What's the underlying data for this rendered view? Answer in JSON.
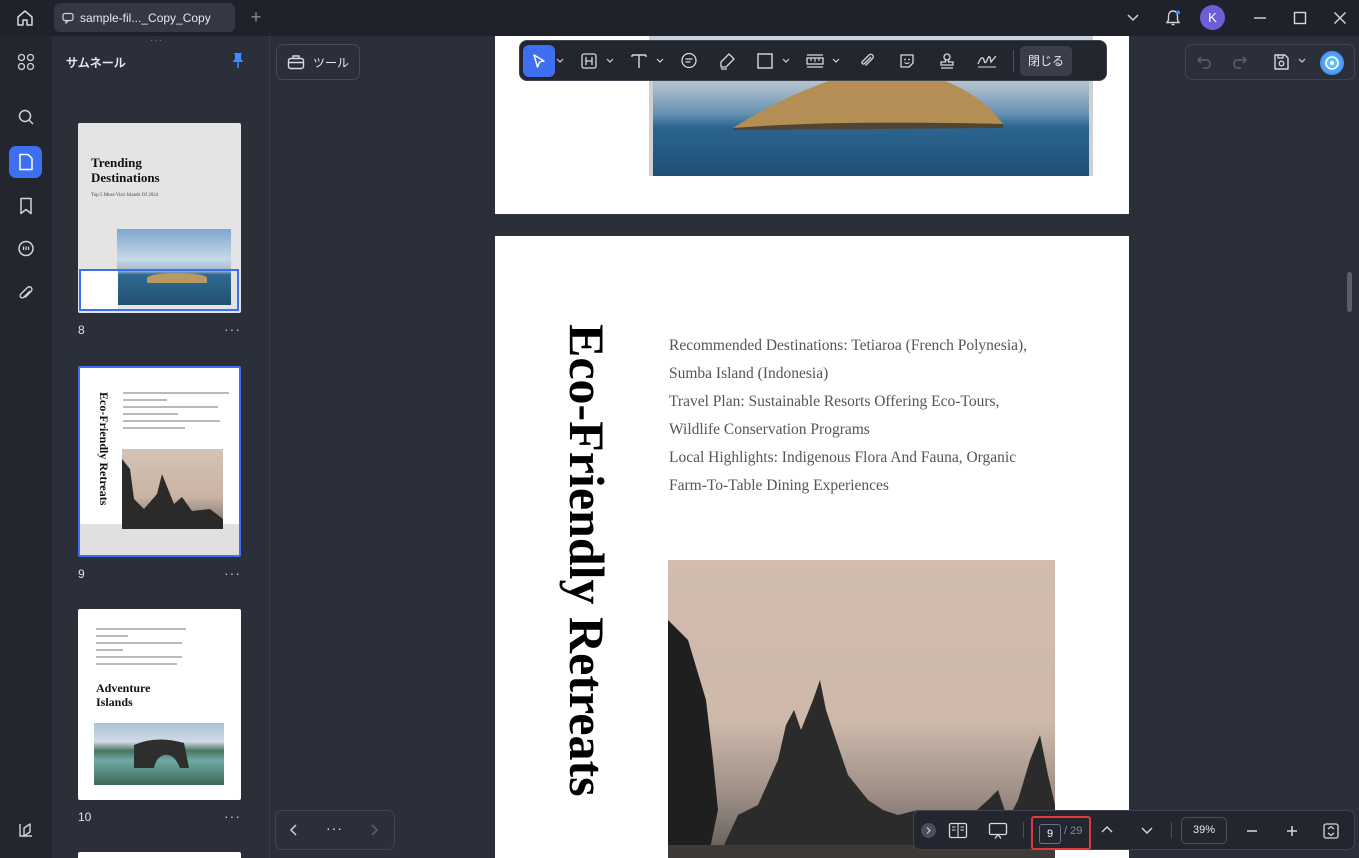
{
  "tab": {
    "title": "sample-fil..._Copy_Copy"
  },
  "user": {
    "initial": "K"
  },
  "panel": {
    "title": "サムネール"
  },
  "thumbnails": [
    {
      "number": "8",
      "title_line1": "Trending",
      "title_line2": "Destinations",
      "subtitle": "Top 5 Must-Visit Islands Of 2024"
    },
    {
      "number": "9",
      "vertical_title": "Eco-Friendly Retreats"
    },
    {
      "number": "10",
      "title_line1": "Adventure",
      "title_line2": "Islands"
    }
  ],
  "tools": {
    "tool_label": "ツール",
    "close_label": "閉じる"
  },
  "document": {
    "vertical_title": "Eco-Friendly Retreats",
    "lines": [
      "Recommended Destinations: Tetiaroa (French Polynesia),",
      "Sumba Island (Indonesia)",
      "Travel Plan: Sustainable Resorts Offering Eco-Tours,",
      "Wildlife Conservation Programs",
      "Local Highlights: Indigenous Flora And Fauna, Organic",
      "Farm-To-Table Dining Experiences"
    ]
  },
  "pager": {
    "current": "9",
    "total": "/ 29",
    "zoom": "39%"
  }
}
